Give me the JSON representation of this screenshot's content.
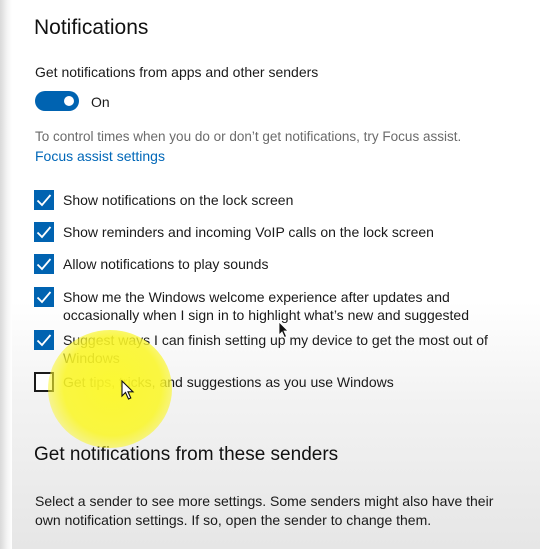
{
  "page": {
    "title": "Notifications"
  },
  "notifications": {
    "master_label": "Get notifications from apps and other senders",
    "master_toggle_state": "On",
    "master_toggle_on": true,
    "hint_text": "To control times when you do or don’t get notifications, try Focus assist.",
    "focus_assist_link": "Focus assist settings"
  },
  "options": [
    {
      "label": "Show notifications on the lock screen",
      "checked": true
    },
    {
      "label": "Show reminders and incoming VoIP calls on the lock screen",
      "checked": true
    },
    {
      "label": "Allow notifications to play sounds",
      "checked": true
    },
    {
      "label": "Show me the Windows welcome experience after updates and occasionally when I sign in to highlight what’s new and suggested",
      "checked": true
    },
    {
      "label": "Suggest ways I can finish setting up my device to get the most out of Windows",
      "checked": true
    },
    {
      "label": "Get tips, tricks, and suggestions as you use Windows",
      "checked": false
    }
  ],
  "senders": {
    "title": "Get notifications from these senders",
    "description": "Select a sender to see more settings. Some senders might also have their own notification settings. If so, open the sender to change them."
  },
  "colors": {
    "accent": "#0063b1",
    "link": "#0067b8",
    "highlight": "#fcf828"
  }
}
